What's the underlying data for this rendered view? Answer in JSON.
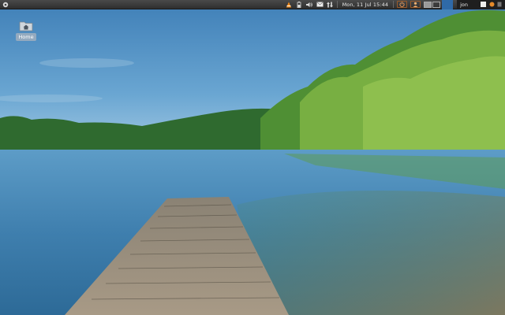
{
  "panel": {
    "clock": "Mon, 11 Jul  15:44",
    "username": "jon",
    "tray_icons": [
      "vlc-icon",
      "battery-icon",
      "volume-icon",
      "mail-icon",
      "network-icon"
    ],
    "workspaces": 2,
    "active_workspace": 1
  },
  "desktop": {
    "icons": [
      {
        "label": "Home",
        "icon": "home-folder-icon"
      }
    ]
  },
  "colors": {
    "panel": "#3a3a3a",
    "accent": "#2f6aa8"
  }
}
